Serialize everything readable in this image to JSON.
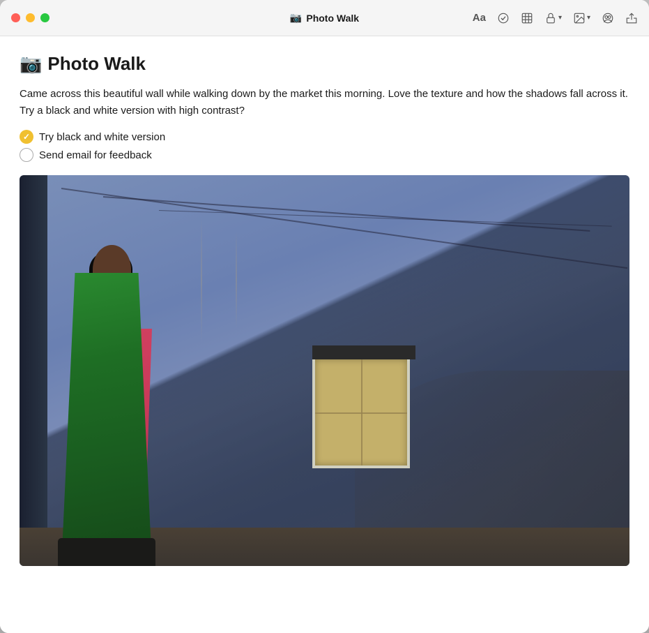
{
  "window": {
    "title": "Photo Walk",
    "emoji": "📷"
  },
  "titlebar": {
    "title": "Photo Walk",
    "emoji": "📷",
    "buttons": {
      "close": "close",
      "minimize": "minimize",
      "maximize": "maximize"
    },
    "actions": {
      "font": "Aa",
      "check_label": "check",
      "grid_label": "grid",
      "lock_label": "lock",
      "photo_label": "photo",
      "collab_label": "collab",
      "share_label": "share"
    }
  },
  "note": {
    "title": "Photo Walk",
    "emoji": "📷",
    "body": "Came across this beautiful wall while walking down by the market this morning. Love the texture and how the shadows fall across it. Try a black and white version with high contrast?",
    "checklist": [
      {
        "text": "Try black and white version",
        "done": true
      },
      {
        "text": "Send email for feedback",
        "done": false
      }
    ]
  }
}
